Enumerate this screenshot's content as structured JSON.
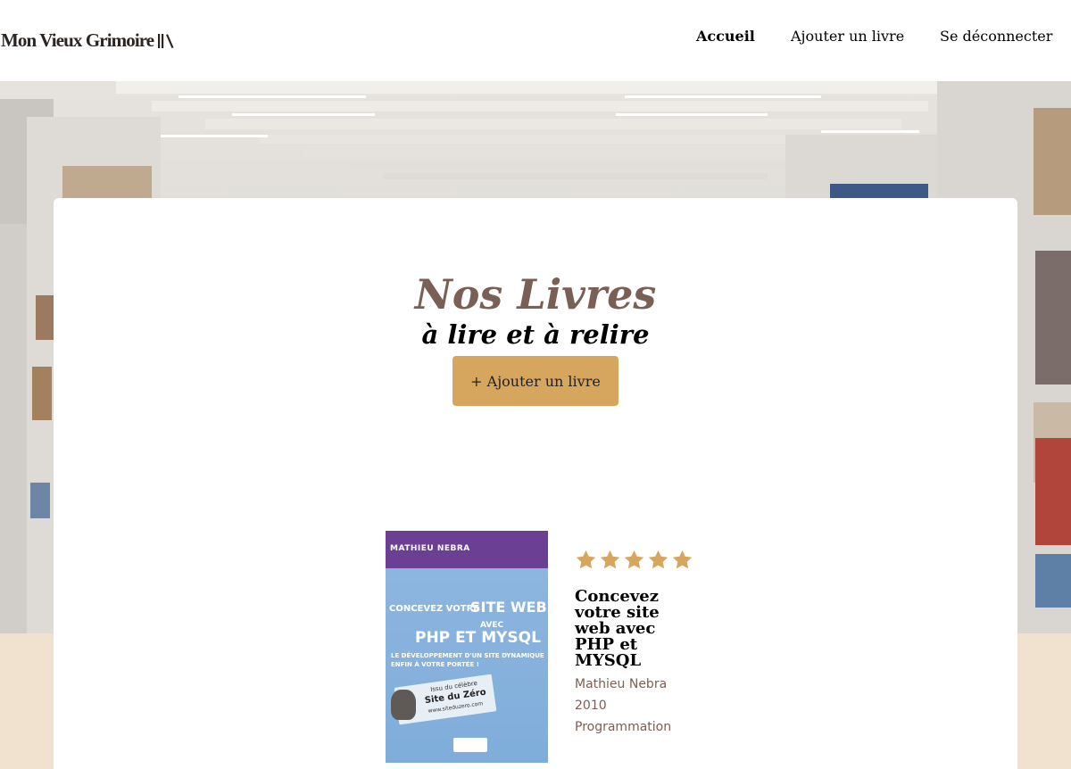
{
  "header": {
    "logo_text": "Mon Vieux Grimoire",
    "nav": {
      "accueil": "Accueil",
      "ajouter": "Ajouter un livre",
      "logout": "Se déconnecter"
    }
  },
  "main": {
    "title": "Nos Livres",
    "subtitle": "à lire et à relire",
    "add_button": "+ Ajouter un livre"
  },
  "books": [
    {
      "title": "Concevez votre site web avec PHP et MYSQL",
      "author": "Mathieu Nebra",
      "year": "2010",
      "genre": "Programmation",
      "rating": 5,
      "cover": {
        "author": "MATHIEU NEBRA",
        "title_line1": "CONCEVEZ VOTRE",
        "title_line2": "SITE WEB",
        "avec": "AVEC",
        "php": "PHP ET MYSQL",
        "subtitle": "LE DÉVELOPPEMENT D'UN SITE DYNAMIQUE ENFIN À VOTRE PORTÉE !",
        "badge_label": "Issu du célèbre",
        "badge_site": "Site du Zéro",
        "badge_url": "www.siteduzero.com"
      }
    }
  ],
  "colors": {
    "accent": "#d6a55e",
    "title": "#7a5f54",
    "star": "#d6a55e",
    "beige_band": "#f1e2cf"
  }
}
